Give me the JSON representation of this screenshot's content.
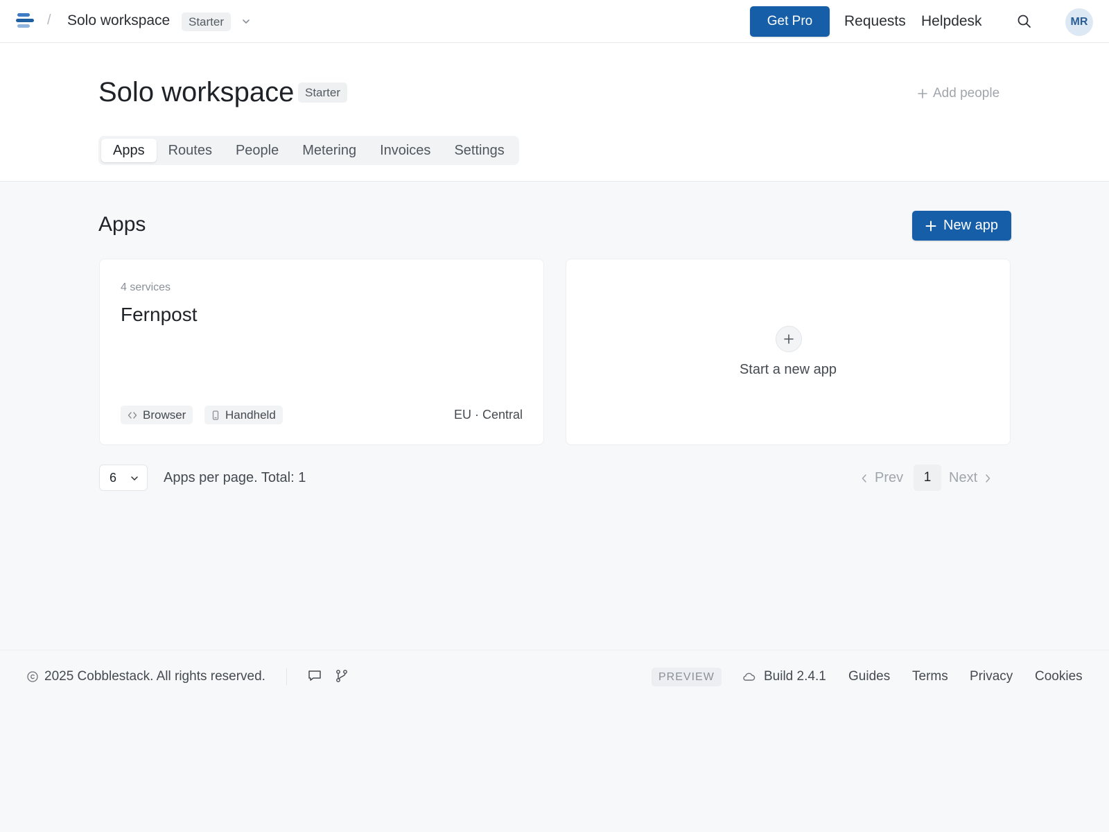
{
  "topbar": {
    "breadcrumb_sep": "/",
    "workspace_name": "Solo workspace",
    "plan": "Starter",
    "get_pro_label": "Get Pro",
    "nav": {
      "requests": "Requests",
      "helpdesk": "Helpdesk"
    },
    "avatar_initials": "MR",
    "icons": {
      "logo": "stack-logo-icon",
      "caret": "chevron-down-icon",
      "search": "search-icon"
    }
  },
  "header": {
    "title": "Solo workspace",
    "plan": "Starter",
    "add_people_label": "Add people",
    "tabs": [
      {
        "label": "Apps",
        "active": true
      },
      {
        "label": "Routes",
        "active": false
      },
      {
        "label": "People",
        "active": false
      },
      {
        "label": "Metering",
        "active": false
      },
      {
        "label": "Invoices",
        "active": false
      },
      {
        "label": "Settings",
        "active": false
      }
    ]
  },
  "apps": {
    "heading": "Apps",
    "new_app_label": "New app",
    "items": [
      {
        "services": "4 services",
        "name": "Fernpost",
        "platforms": [
          "Browser",
          "Handheld"
        ],
        "region": "EU · Central"
      }
    ],
    "new_card_label": "Start a new app"
  },
  "pagination": {
    "per_page": "6",
    "summary": "Apps per page. Total: 1",
    "prev_label": "Prev",
    "current_page": "1",
    "next_label": "Next"
  },
  "footer": {
    "copyright": "2025 Cobblestack. All rights reserved.",
    "preview_badge": "PREVIEW",
    "build": "Build 2.4.1",
    "links": {
      "guides": "Guides",
      "terms": "Terms",
      "privacy": "Privacy",
      "cookies": "Cookies"
    }
  },
  "colors": {
    "accent": "#165fa8",
    "page_bg": "#f7f8fa",
    "surface": "#ffffff",
    "avatar_bg": "#dde8f5"
  }
}
